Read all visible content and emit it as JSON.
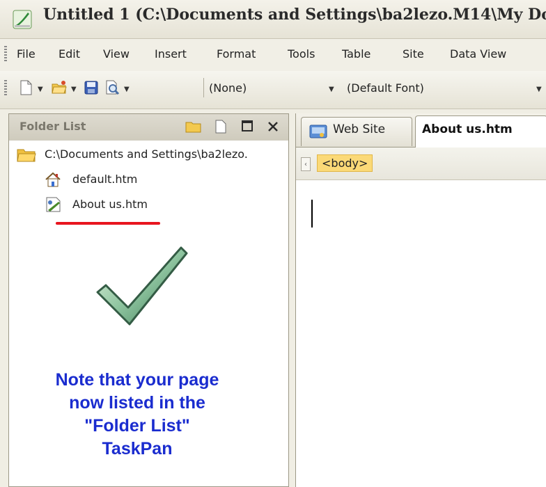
{
  "window": {
    "title": "Untitled 1 (C:\\Documents and Settings\\ba2lezo.M14\\My Do"
  },
  "menu": [
    {
      "label": "File"
    },
    {
      "label": "Edit"
    },
    {
      "label": "View"
    },
    {
      "label": "Insert"
    },
    {
      "label": "Format"
    },
    {
      "label": "Tools"
    },
    {
      "label": "Table"
    },
    {
      "label": "Site"
    },
    {
      "label": "Data View"
    }
  ],
  "toolbar": {
    "style_value": "(None)",
    "font_value": "(Default Font)",
    "icons": [
      "new-page-icon",
      "open-folder-icon",
      "save-icon",
      "print-preview-icon"
    ]
  },
  "folder_list": {
    "title": "Folder List",
    "root": "C:\\Documents and Settings\\ba2lezo.",
    "items": [
      {
        "label": "default.htm",
        "icon": "home-page-icon"
      },
      {
        "label": "About us.htm",
        "icon": "web-page-icon"
      }
    ]
  },
  "annotation": {
    "lines": [
      "Note that your page",
      "now listed in the",
      "\"Folder List\"",
      "TaskPan"
    ],
    "color": "#1a2ccf",
    "underline_color": "#e8151f"
  },
  "editor": {
    "tabs": [
      {
        "label": "Web Site",
        "active": false
      },
      {
        "label": "About us.htm",
        "active": true
      }
    ],
    "quick_tag": "<body>"
  }
}
